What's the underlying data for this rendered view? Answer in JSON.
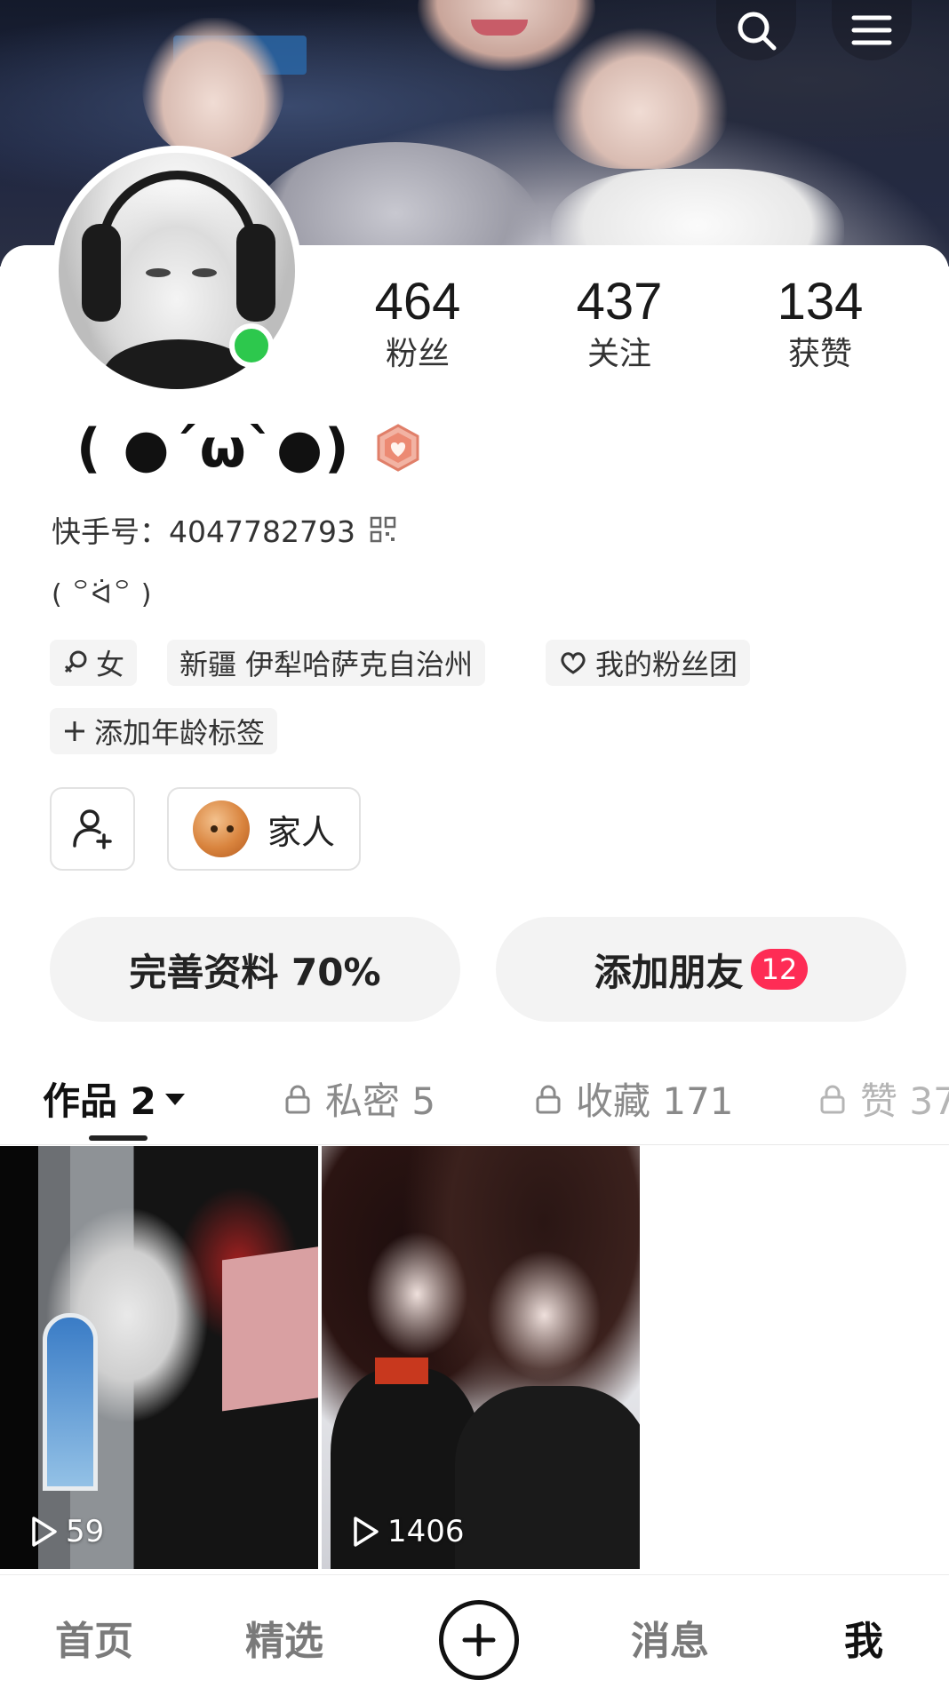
{
  "header": {
    "search_icon": "search-icon",
    "menu_icon": "menu-icon"
  },
  "profile": {
    "stats": [
      {
        "value": "464",
        "label": "粉丝"
      },
      {
        "value": "437",
        "label": "关注"
      },
      {
        "value": "134",
        "label": "获赞"
      }
    ],
    "nickname": "( ●´ω`●)",
    "uid_label": "快手号：4047782793",
    "bio": "( ꒪ᐛ꒪ )",
    "online_status_color": "#2dc84d",
    "tags": [
      {
        "icon": "female-icon",
        "label": "女"
      },
      {
        "icon": "",
        "label": "新疆 伊犁哈萨克自治州"
      },
      {
        "icon": "heart-icon",
        "label": "我的粉丝团"
      },
      {
        "icon": "plus-icon",
        "label": "添加年龄标签"
      }
    ],
    "family_label": "家人"
  },
  "actions": {
    "complete_profile": "完善资料 70%",
    "add_friends": "添加朋友",
    "add_friends_badge": "12"
  },
  "tabs": [
    {
      "label": "作品 2",
      "locked": false,
      "active": true
    },
    {
      "label": "私密 5",
      "locked": true,
      "active": false
    },
    {
      "label": "收藏 171",
      "locked": true,
      "active": false
    },
    {
      "label": "赞 37",
      "locked": true,
      "active": false
    }
  ],
  "videos": [
    {
      "plays": "59"
    },
    {
      "plays": "1406"
    }
  ],
  "bottom_nav": {
    "home": "首页",
    "featured": "精选",
    "messages": "消息",
    "me": "我"
  },
  "colors": {
    "accent_red": "#fe2c55",
    "online_green": "#2dc84d"
  }
}
